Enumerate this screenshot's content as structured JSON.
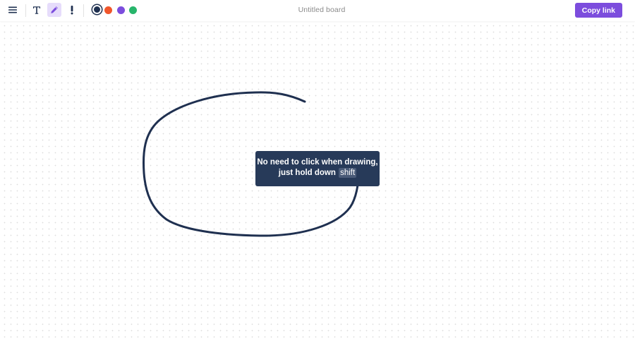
{
  "toolbar": {
    "menu_icon": "hamburger-menu-icon",
    "text_tool_icon": "text-tool-icon",
    "pen_tool_icon": "pen-tool-icon",
    "pen_tool_active": true,
    "exclamation_tool_icon": "exclamation-icon",
    "colors": [
      {
        "name": "navy",
        "hex": "#1f3050",
        "selected": true
      },
      {
        "name": "orange",
        "hex": "#f0562b",
        "selected": false
      },
      {
        "name": "purple",
        "hex": "#7c4ddd",
        "selected": false
      },
      {
        "name": "green",
        "hex": "#27b56b",
        "selected": false
      }
    ]
  },
  "board": {
    "title": "Untitled board"
  },
  "actions": {
    "copy_link_label": "Copy link",
    "accent_color": "#7c4ddd"
  },
  "hint": {
    "line1": "No need to click when drawing,",
    "line2_prefix": "just hold down",
    "key": "shift"
  },
  "drawing": {
    "stroke_color": "#1f3050"
  }
}
